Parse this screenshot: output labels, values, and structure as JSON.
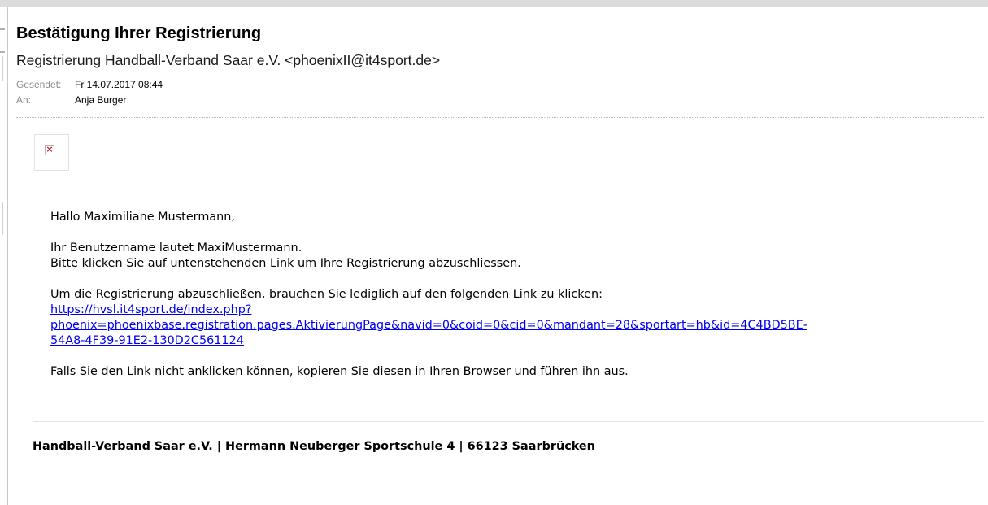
{
  "email": {
    "subject": "Bestätigung Ihrer Registrierung",
    "sender": "Registrierung Handball-Verband Saar e.V. <phoenixII@it4sport.de>",
    "sent_label": "Gesendet:",
    "sent_value": "Fr 14.07.2017 08:44",
    "to_label": "An:",
    "to_value": "Anja Burger"
  },
  "image_placeholder": {
    "icon": "broken-image-icon"
  },
  "body": {
    "greeting": "Hallo Maximiliane Mustermann,",
    "line1": "Ihr Benutzername lautet MaxiMustermann.",
    "line2": "Bitte klicken Sie auf untenstehenden Link um Ihre Registrierung abzuschliessen.",
    "line3": "Um die Registrierung abzuschließen, brauchen Sie lediglich auf den folgenden Link zu klicken:",
    "link_line1": "https://hvsl.it4sport.de/index.php?",
    "link_line2": "phoenix=phoenixbase.registration.pages.AktivierungPage&navid=0&coid=0&cid=0&mandant=28&sportart=hb&id=4C4BD5BE-",
    "link_line3": "54A8-4F39-91E2-130D2C561124",
    "line4": "Falls Sie den Link nicht anklicken können, kopieren Sie diesen in Ihren Browser und führen ihn aus."
  },
  "footer": {
    "text": "Handball-Verband Saar e.V. | Hermann Neuberger Sportschule 4 | 66123 Saarbrücken"
  },
  "colors": {
    "link": "#0000ee",
    "meta_label": "#8a8a8a"
  }
}
